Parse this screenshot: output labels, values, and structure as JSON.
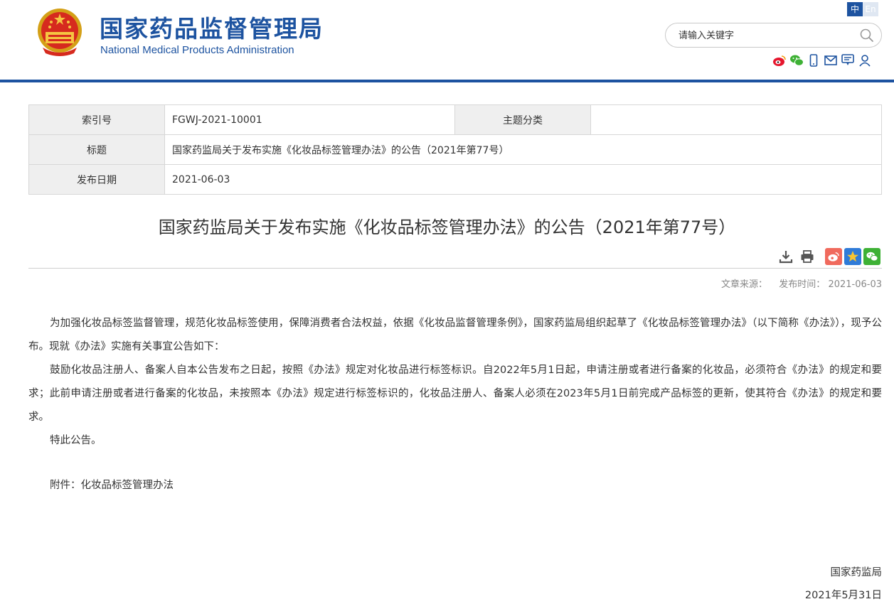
{
  "header": {
    "site_title": "国家药品监督管理局",
    "site_subtitle": "National Medical Products Administration",
    "lang_zh": "中",
    "lang_en": "En",
    "search_placeholder": "请输入关键字",
    "brand_color": "#1d53a0",
    "social_icons": [
      "weibo-icon",
      "wechat-icon",
      "mobile-icon",
      "mail-icon",
      "chat-icon",
      "user-icon"
    ]
  },
  "meta": {
    "index_label": "索引号",
    "index_value": "FGWJ-2021-10001",
    "category_label": "主题分类",
    "category_value": "",
    "title_label": "标题",
    "title_value": "国家药监局关于发布实施《化妆品标签管理办法》的公告（2021年第77号）",
    "date_label": "发布日期",
    "date_value": "2021-06-03"
  },
  "article": {
    "title": "国家药监局关于发布实施《化妆品标签管理办法》的公告（2021年第77号）",
    "source_label": "文章来源：",
    "publish_label": "发布时间：",
    "publish_date": "2021-06-03",
    "paragraphs": [
      "为加强化妆品标签监督管理，规范化妆品标签使用，保障消费者合法权益，依据《化妆品监督管理条例》，国家药监局组织起草了《化妆品标签管理办法》（以下简称《办法》），现予公布。现就《办法》实施有关事宜公告如下：",
      "鼓励化妆品注册人、备案人自本公告发布之日起，按照《办法》规定对化妆品进行标签标识。自2022年5月1日起，申请注册或者进行备案的化妆品，必须符合《办法》的规定和要求；此前申请注册或者进行备案的化妆品，未按照本《办法》规定进行标签标识的，化妆品注册人、备案人必须在2023年5月1日前完成产品标签的更新，使其符合《办法》的规定和要求。",
      "特此公告。"
    ],
    "attachment": "附件：化妆品标签管理办法",
    "signature": "国家药监局",
    "signature_date": "2021年5月31日"
  }
}
